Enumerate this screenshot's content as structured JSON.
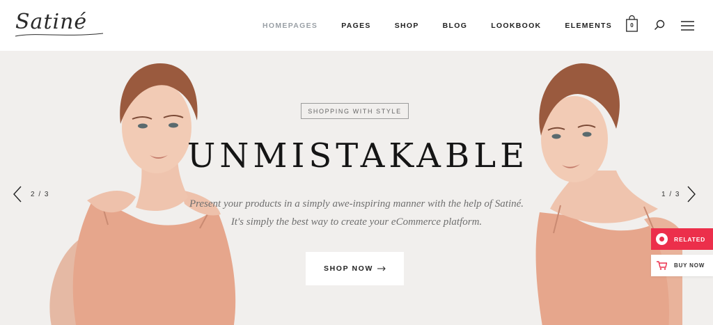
{
  "brand": {
    "logo": "Satiné"
  },
  "nav": {
    "items": [
      {
        "label": "HOMEPAGES",
        "active": true
      },
      {
        "label": "PAGES"
      },
      {
        "label": "SHOP"
      },
      {
        "label": "BLOG"
      },
      {
        "label": "LOOKBOOK"
      },
      {
        "label": "ELEMENTS"
      }
    ],
    "cart_count": "0",
    "icons": [
      "shopping-bag-icon",
      "search-icon",
      "hamburger-menu-icon"
    ]
  },
  "hero": {
    "tagline": "SHOPPING WITH STYLE",
    "headline": "UNMISTAKABLE",
    "description_line1": "Present your products in a simply awe-inspiring manner with the help of Satiné.",
    "description_line2": "It's simply the best way to create your eCommerce platform.",
    "cta_label": "SHOP NOW",
    "prev_counter": "2 / 3",
    "next_counter": "1 / 3"
  },
  "side": {
    "related_label": "RELATED",
    "buy_label": "BUY NOW"
  },
  "colors": {
    "accent": "#ec2f4b",
    "hero_bg": "#f1efed",
    "nav_active": "#9aa0a6"
  }
}
